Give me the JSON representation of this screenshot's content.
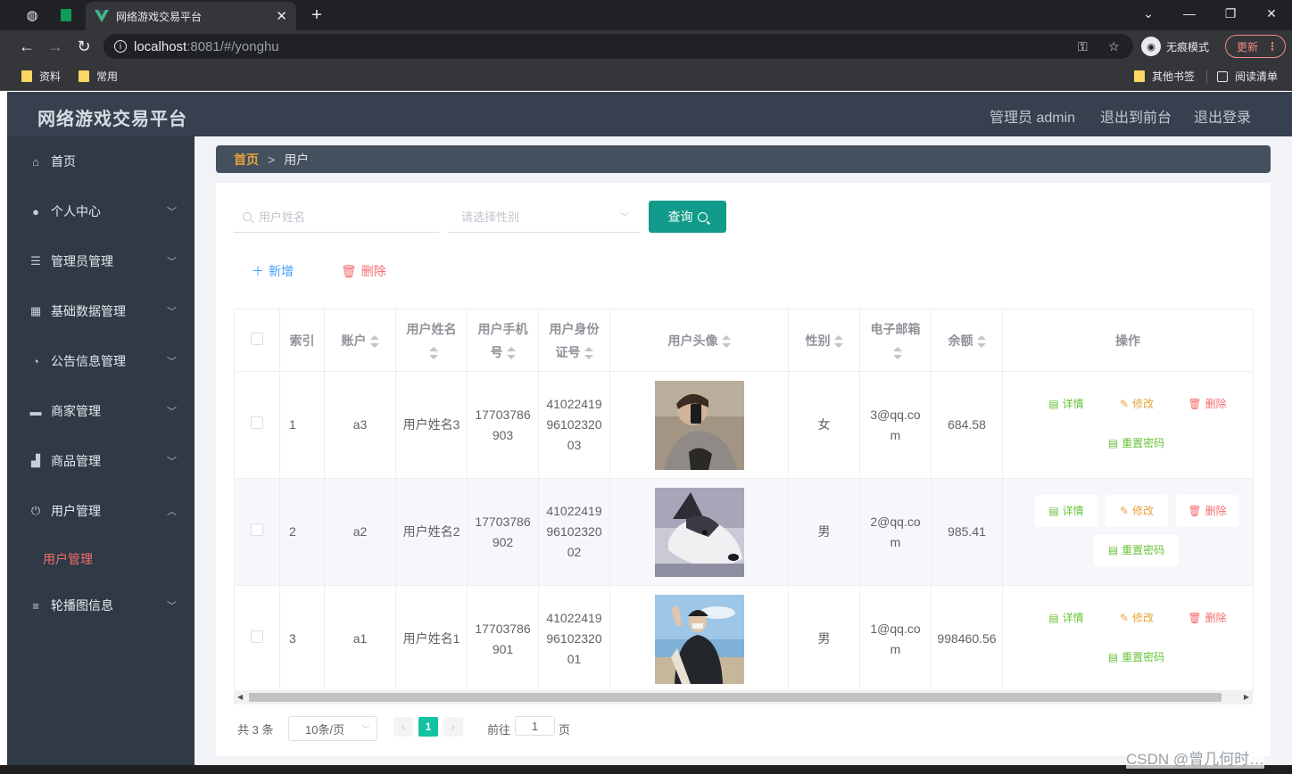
{
  "browser": {
    "tab_title": "网络游戏交易平台",
    "url_host": "localhost",
    "url_path": ":8081/#/yonghu",
    "incognito_label": "无痕模式",
    "update_label": "更新",
    "bookmarks": [
      "资料",
      "常用"
    ],
    "bookmarks_right": [
      "其他书签",
      "阅读清单"
    ]
  },
  "header": {
    "title": "网络游戏交易平台",
    "admin": "管理员 admin",
    "to_front": "退出到前台",
    "logout": "退出登录"
  },
  "sidebar": {
    "items": [
      {
        "label": "首页",
        "icon": "home-icon"
      },
      {
        "label": "个人中心",
        "icon": "user-icon"
      },
      {
        "label": "管理员管理",
        "icon": "list-icon"
      },
      {
        "label": "基础数据管理",
        "icon": "grid-icon"
      },
      {
        "label": "公告信息管理",
        "icon": "gauge-icon"
      },
      {
        "label": "商家管理",
        "icon": "briefcase-icon"
      },
      {
        "label": "商品管理",
        "icon": "goods-icon"
      },
      {
        "label": "用户管理",
        "icon": "power-icon"
      },
      {
        "label": "轮播图信息",
        "icon": "menu-icon"
      }
    ],
    "sub_active": "用户管理"
  },
  "breadcrumb": {
    "home": "首页",
    "current": "用户"
  },
  "search": {
    "name_placeholder": "用户姓名",
    "gender_placeholder": "请选择性别",
    "query_label": "查询"
  },
  "actions": {
    "add": "新增",
    "delete": "删除"
  },
  "table": {
    "headers": {
      "index": "索引",
      "account": "账户",
      "name": "用户姓名",
      "phone": "用户手机号",
      "idcard": "用户身份证号",
      "avatar": "用户头像",
      "gender": "性别",
      "email": "电子邮箱",
      "balance": "余额",
      "ops": "操作"
    },
    "rows": [
      {
        "index": "1",
        "account": "a3",
        "name": "用户姓名3",
        "phone": "17703786903",
        "idcard": "410224199610232003",
        "gender": "女",
        "email": "3@qq.com",
        "balance": "684.58"
      },
      {
        "index": "2",
        "account": "a2",
        "name": "用户姓名2",
        "phone": "17703786902",
        "idcard": "410224199610232002",
        "gender": "男",
        "email": "2@qq.com",
        "balance": "985.41"
      },
      {
        "index": "3",
        "account": "a1",
        "name": "用户姓名1",
        "phone": "17703786901",
        "idcard": "410224199610232001",
        "gender": "男",
        "email": "1@qq.com",
        "balance": "998460.56"
      }
    ],
    "op_labels": {
      "detail": "详情",
      "edit": "修改",
      "remove": "删除",
      "reset": "重置密码"
    }
  },
  "pagination": {
    "total": "共 3 条",
    "page_size": "10条/页",
    "current": "1",
    "goto_label": "前往",
    "goto_value": "1",
    "page_suffix": "页"
  },
  "watermark": "CSDN @曾几何时…",
  "colors": {
    "accent": "#129b8a",
    "sidebar": "#2f3a46",
    "header": "#36404e",
    "active_sub": "#f56c6c"
  }
}
